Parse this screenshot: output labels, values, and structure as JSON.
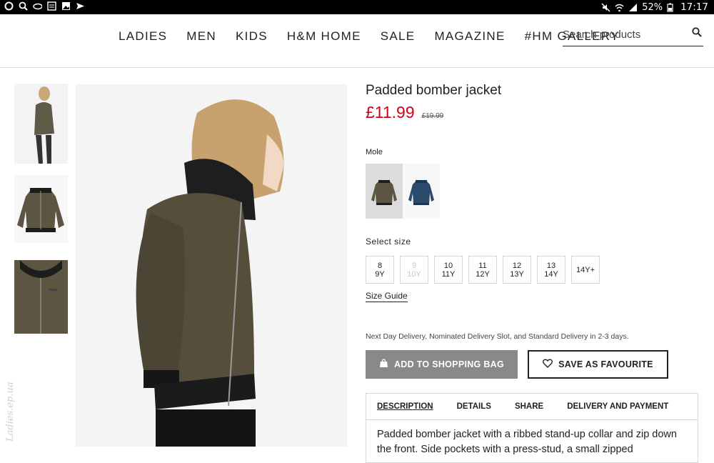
{
  "statusbar": {
    "battery": "52%",
    "time": "17:17"
  },
  "nav": {
    "links": [
      "LADIES",
      "MEN",
      "KIDS",
      "H&M HOME",
      "SALE",
      "MAGAZINE",
      "#HM GALLERY"
    ],
    "search_placeholder": "Search products"
  },
  "product": {
    "title": "Padded bomber jacket",
    "price": "£11.99",
    "old_price": "£19.99",
    "color_name": "Mole",
    "colors": [
      "mole",
      "dark blue"
    ],
    "size_label": "Select size",
    "sizes": [
      {
        "top": "8",
        "bottom": "9Y",
        "available": true
      },
      {
        "top": "9",
        "bottom": "10Y",
        "available": false
      },
      {
        "top": "10",
        "bottom": "11Y",
        "available": true
      },
      {
        "top": "11",
        "bottom": "12Y",
        "available": true
      },
      {
        "top": "12",
        "bottom": "13Y",
        "available": true
      },
      {
        "top": "13",
        "bottom": "14Y",
        "available": true
      },
      {
        "top": "14Y+",
        "bottom": "",
        "available": true
      }
    ],
    "size_guide": "Size Guide",
    "delivery": "Next Day Delivery, Nominated Delivery Slot, and Standard Delivery in 2-3 days.",
    "add_to_bag": "ADD TO SHOPPING BAG",
    "save_fav": "SAVE AS FAVOURITE",
    "tabs": [
      "DESCRIPTION",
      "DETAILS",
      "SHARE",
      "DELIVERY AND PAYMENT"
    ],
    "description": "Padded bomber jacket with a ribbed stand-up collar and zip down the front. Side pockets with a press-stud, a small zipped"
  },
  "watermark": "Ladies.ep.ua",
  "colors": {
    "sale_red": "#d0021b",
    "bag_button": "#898989",
    "jacket_khaki": "#5b5541",
    "jacket_navy": "#2c4a6b"
  }
}
